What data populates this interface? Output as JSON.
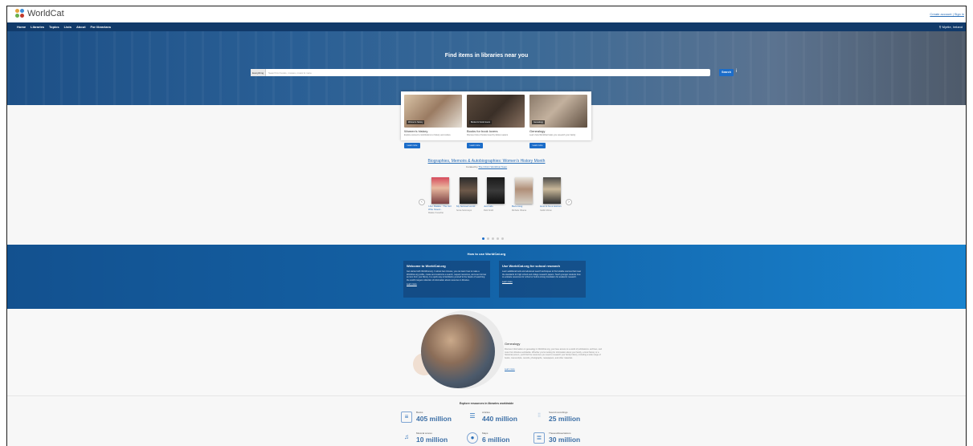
{
  "app": {
    "logo_text": "WorldCat",
    "top_links": "Create account | Sign in"
  },
  "nav": {
    "items": [
      "Home",
      "Libraries",
      "Topics",
      "Lists",
      "About",
      "For librarians"
    ],
    "location": "Myrtle, Ireland"
  },
  "hero": {
    "title": "Find items in libraries near you",
    "search_scope": "Everything",
    "search_placeholder": "Search for books, movies, music & more",
    "search_button": "Search",
    "help": "i"
  },
  "cards": [
    {
      "title": "Women's history",
      "tag": "Women's history",
      "desc": "Explore women's contributions to history and culture",
      "button": "Learn more"
    },
    {
      "title": "Books for book lovers",
      "tag": "Books for book lovers",
      "desc": "Discover lists of books loved by fellow readers",
      "button": "Learn more"
    },
    {
      "title": "Genealogy",
      "tag": "Genealogy",
      "desc": "Learn how WorldCat helps you research your family",
      "button": "Learn more"
    }
  ],
  "list": {
    "title": "Biographies, Memoirs & Autobiographies: Women's History Month",
    "curated_prefix": "Curated by",
    "curated_by": "The OCLC WorldCat Team",
    "prev": "‹",
    "next": "›",
    "books": [
      {
        "title": "I Am Malala : The Girl Who Stood...",
        "author": "Malala Yousafzai"
      },
      {
        "title": "My beloved world",
        "author": "Sonia Sotomayor"
      },
      {
        "title": "Just kids",
        "author": "Patti Smith"
      },
      {
        "title": "Becoming",
        "author": "Michelle Obama"
      },
      {
        "title": "How to be a woman",
        "author": "Caitlin Moran"
      }
    ]
  },
  "howto": {
    "title": "How to use WorldCat.org",
    "boxes": [
      {
        "title": "Welcome to WorldCat.org",
        "text": "Get started with WorldCat.org. In about two minutes, you can learn how to make a WorldCat.org profile, create and customize a search, request resources, and even borrow an item from your library. In a quick way to familiarize yourself to the basics of searching the world's largest collection of information about resources in libraries.",
        "link": "Learn more"
      },
      {
        "title": "Use WorldCat.org for school research",
        "text": "Learn additional tools and advanced search techniques to find reliable sources that meet the standards for high school and college research papers. Teach younger students how to evaluate resources for school or build a strong foundation for academic research.",
        "link": "Learn more"
      }
    ]
  },
  "feature": {
    "title": "Genealogy",
    "text": "Discover information on genealogy in WorldCat.org, you have access to a world of publications, archives, and more from libraries worldwide. Whether you're looking for information about your family, a local history or a historical person, you'll find the resources you need to research your family history, including a wide range of books, manuscripts, records, photographs, newspapers, and other materials.",
    "link": "Learn more"
  },
  "stats": {
    "title": "Explore resources in libraries worldwide",
    "items": [
      {
        "label": "Books",
        "value": "405 million",
        "icon": "book-icon"
      },
      {
        "label": "Articles",
        "value": "440 million",
        "icon": "article-icon"
      },
      {
        "label": "Sound recordings",
        "value": "25 million",
        "icon": "sound-icon"
      },
      {
        "label": "Musical scores",
        "value": "10 million",
        "icon": "music-icon"
      },
      {
        "label": "Maps",
        "value": "6 million",
        "icon": "map-icon"
      },
      {
        "label": "Theses/dissertations",
        "value": "30 million",
        "icon": "thesis-icon"
      }
    ]
  }
}
